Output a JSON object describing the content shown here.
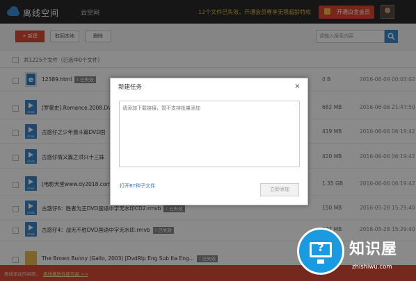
{
  "header": {
    "app_title": "离线空间",
    "tab_cloud": "云空间",
    "promo": "12个文件已失效，开通会员尊享无限超龄特权",
    "vip_button": "开通白金会员"
  },
  "toolbar": {
    "new_label": "+ 新建",
    "local_label": "取回本地",
    "delete_label": "删除",
    "search_placeholder": "请输入搜索内容"
  },
  "list": {
    "count_text": "共1225个文件（已选中0个文件）",
    "rows": [
      {
        "name": "12389.html",
        "badge": "已失效",
        "size": "0 B",
        "date": "2016-06-09 00:03:02",
        "icon": "html-file-icon"
      },
      {
        "name": "[罗曼史].Romance.2008.DVD",
        "badge": "",
        "size": "682 MB",
        "date": "2016-06-06 21:47:50",
        "icon": "video-file-icon"
      },
      {
        "name": "古惑仔之少年激斗篇DVD国",
        "badge": "",
        "size": "419 MB",
        "date": "2016-06-06 06:19:42",
        "icon": "video-file-icon"
      },
      {
        "name": "古惑仔情义篇之洪兴十三妹",
        "badge": "",
        "size": "420 MB",
        "date": "2016-06-06 06:19:42",
        "icon": "video-file-icon"
      },
      {
        "name": "[电影天堂www.dy2018.com",
        "badge": "",
        "size": "1.35 GB",
        "date": "2016-06-06 06:19:42",
        "icon": "video-file-icon"
      },
      {
        "name": "古惑仔6：胜者为王DVD国语中字无水印CD2.rmvb",
        "badge": "已失效",
        "size": "150 MB",
        "date": "2016-05-28 15:29:40",
        "icon": "video-file-icon"
      },
      {
        "name": "古惑仔4：战无不胜DVD国语中字无水印.rmvb",
        "badge": "已失效",
        "size": "297 MB",
        "date": "2016-05-28 15:29:40",
        "icon": "video-file-icon"
      },
      {
        "name": "The Brown Bunny (Gallo, 2003) [DvdRip Eng Sub Ita Eng...",
        "badge": "已失效",
        "size": "",
        "date": "",
        "icon": "folder-icon"
      }
    ]
  },
  "modal": {
    "title": "新建任务",
    "close": "×",
    "textarea_placeholder": "请添加下载链接，暂不支持批量添加",
    "bt_link": "打开BT种子文件",
    "submit": "立即添加"
  },
  "bottom_bar": {
    "text": "离线添加的视频，",
    "link": "离线播放性能可高 >>"
  },
  "watermark": {
    "title": "知识屋",
    "url": "zhishiwu.com"
  },
  "colors": {
    "accent_red": "#e04a36",
    "link_blue": "#3a7bc8",
    "promo_gold": "#e9b84d"
  }
}
